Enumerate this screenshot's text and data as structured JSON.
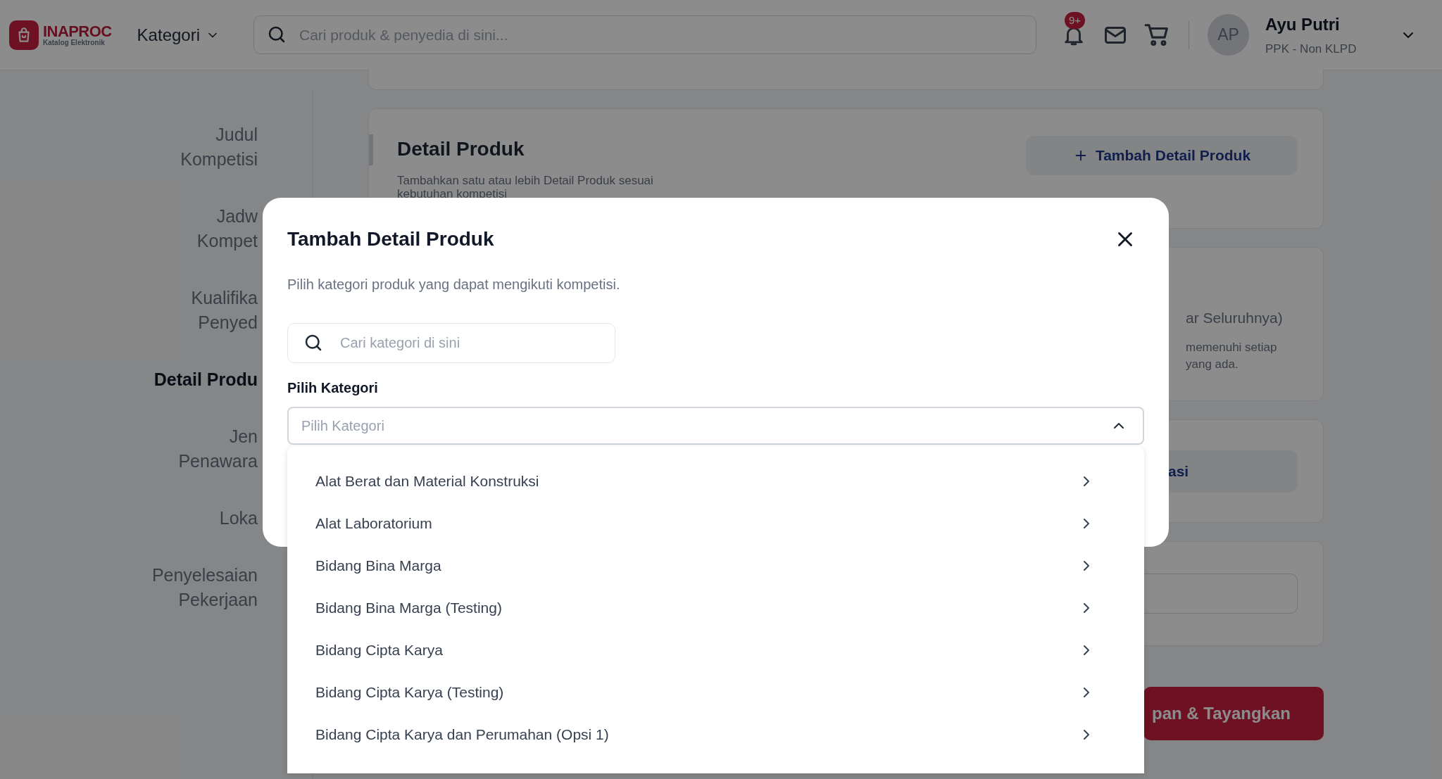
{
  "header": {
    "logo": {
      "name": "INAPROC",
      "tagline": "Katalog Elektronik"
    },
    "category_menu": "Kategori",
    "search": {
      "placeholder": "Cari produk & penyedia di sini..."
    },
    "notification_badge": "9+",
    "user": {
      "initials": "AP",
      "name": "Ayu Putri",
      "role": "PPK - Non KLPD"
    }
  },
  "sidebar": {
    "items": [
      {
        "lines": [
          "Judul",
          "Kompetisi"
        ],
        "selected": false
      },
      {
        "lines": [
          "Jadw",
          "Kompet"
        ],
        "selected": false
      },
      {
        "lines": [
          "Kualifika",
          "Penyed"
        ],
        "selected": false
      },
      {
        "lines": [
          "Detail Produ"
        ],
        "selected": true
      },
      {
        "lines": [
          "Jen",
          "Penawara"
        ],
        "selected": false
      },
      {
        "lines": [
          "Loka"
        ],
        "selected": false
      },
      {
        "lines": [
          "Penyelesaian",
          "Pekerjaan"
        ],
        "selected": false
      }
    ]
  },
  "background_cards": [
    {
      "kind": "empty"
    },
    {
      "kind": "section",
      "title": "Detail Produk",
      "description": "Tambahkan satu atau lebih Detail Produk sesuai",
      "description_2": "kebutuhan kompetisi",
      "button": "Tambah Detail Produk"
    },
    {
      "kind": "text",
      "title": "ar Seluruhnya)",
      "lines": [
        "memenuhi setiap",
        "yang ada."
      ]
    },
    {
      "kind": "button",
      "button": "asi"
    },
    {
      "kind": "input"
    }
  ],
  "submit_button": "pan & Tayangkan",
  "modal": {
    "title": "Tambah Detail Produk",
    "subtitle": "Pilih kategori produk yang dapat mengikuti kompetisi.",
    "search": {
      "placeholder": "Cari kategori di sini"
    },
    "select_label": "Pilih Kategori",
    "select": {
      "placeholder": "Pilih Kategori",
      "expanded": true
    },
    "options": [
      "Alat Berat dan Material Konstruksi",
      "Alat Laboratorium",
      "Bidang Bina Marga",
      "Bidang Bina Marga (Testing)",
      "Bidang Cipta Karya",
      "Bidang Cipta Karya (Testing)",
      "Bidang Cipta Karya dan Perumahan (Opsi 1)"
    ]
  }
}
